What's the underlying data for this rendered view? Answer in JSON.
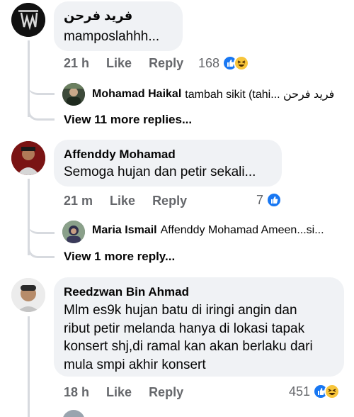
{
  "comments": [
    {
      "author": "فريد فرحن",
      "text": "mamposlahhh...",
      "time": "21 h",
      "like_label": "Like",
      "reply_label": "Reply",
      "reaction_count": "168",
      "reactions": [
        "like",
        "haha"
      ],
      "reply_preview": {
        "name": "Mohamad Haikal",
        "text": "tambah sikit (tahi... فريد فرحن"
      },
      "view_more": "View 11 more replies..."
    },
    {
      "author": "Affenddy Mohamad",
      "text": "Semoga hujan dan petir sekali...",
      "time": "21 m",
      "like_label": "Like",
      "reply_label": "Reply",
      "reaction_count": "7",
      "reactions": [
        "like"
      ],
      "reply_preview": {
        "name": "Maria Ismail",
        "text": "Affenddy Mohamad Ameen...si..."
      },
      "view_more": "View 1 more reply..."
    },
    {
      "author": "Reedzwan Bin Ahmad",
      "text_lines": [
        "Mlm es9k hujan batu di iringi angin dan",
        "ribut petir melanda hanya di lokasi tapak",
        "konsert shj,di ramal kan akan berlaku dari",
        "mula smpi akhir konsert"
      ],
      "time": "18 h",
      "like_label": "Like",
      "reply_label": "Reply",
      "reaction_count": "451",
      "reactions": [
        "like",
        "haha"
      ]
    }
  ],
  "colors": {
    "bubble": "#f0f2f5",
    "meta_text": "#65676b",
    "like_blue": "#1877f2",
    "haha_yellow": "#f7c53b",
    "thread_line": "#d7dadf"
  }
}
